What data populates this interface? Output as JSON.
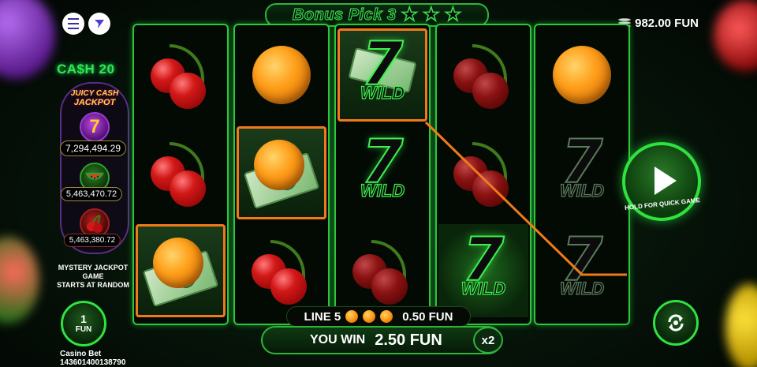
{
  "header": {
    "bonus_title": "Bonus Pick 3",
    "stars": 3,
    "balance": "982.00 FUN"
  },
  "jackpot": {
    "brand": "CA$H 20",
    "label_line1": "JUICY CASH",
    "label_line2": "JACKPOT",
    "tiers": [
      {
        "symbol": "seven",
        "value": "7,294,494.29"
      },
      {
        "symbol": "watermelon",
        "value": "5,463,470.72"
      },
      {
        "symbol": "cherry",
        "value": "5,463,380.72"
      }
    ],
    "mystery_line1": "MYSTERY JACKPOT GAME",
    "mystery_line2": "STARTS AT RANDOM"
  },
  "reels": [
    [
      "cherry",
      "cherry",
      "orange-cash"
    ],
    [
      "orange",
      "orange-cash",
      "cherry"
    ],
    [
      "wild-cash",
      "wild",
      "cherry"
    ],
    [
      "cherry",
      "cherry",
      "wild"
    ],
    [
      "orange",
      "wild",
      "wild"
    ]
  ],
  "winning_cells": [
    [
      0,
      2
    ],
    [
      1,
      1
    ],
    [
      2,
      0
    ]
  ],
  "play": {
    "hold_text": "HOLD FOR QUICK GAME"
  },
  "bet": {
    "value": "1",
    "unit": "FUN",
    "casino_label": "Casino Bet",
    "bet_id": "143601400138790"
  },
  "line_info": {
    "line_label": "LINE 5",
    "symbol_count": 3,
    "amount": "0.50 FUN"
  },
  "win": {
    "label": "YOU WIN",
    "amount": "2.50 FUN",
    "multiplier": "x2"
  },
  "colors": {
    "accent": "#2ee33f",
    "win_outline": "#f07a1a",
    "jackpot_gold": "#ffd54a"
  }
}
